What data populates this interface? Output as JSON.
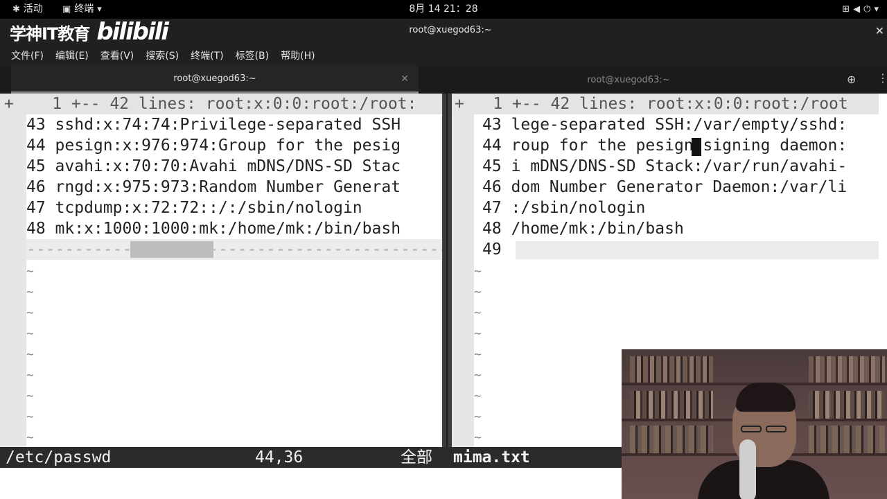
{
  "topbar": {
    "activities": "活动",
    "app_menu": "终端",
    "clock": "8月 14  21：28"
  },
  "window": {
    "logo_text": "学神IT教育",
    "logo_brand": "bilibili",
    "title": "root@xuegod63:~"
  },
  "menubar": [
    "文件(F)",
    "编辑(E)",
    "查看(V)",
    "搜索(S)",
    "终端(T)",
    "标签(B)",
    "帮助(H)"
  ],
  "tabs": [
    {
      "label": "root@xuegod63:~",
      "active": true
    },
    {
      "label": "root@xuegod63:~",
      "active": false
    }
  ],
  "left_pane": {
    "fold_line": "+    1 +-- 42 lines: root:x:0:0:root:/root:",
    "lines": [
      "43 sshd:x:74:74:Privilege-separated SSH",
      "44 pesign:x:976:974:Group for the pesig",
      "45 avahi:x:70:70:Avahi mDNS/DNS-SD Stac",
      "46 rngd:x:975:973:Random Number Generat",
      "47 tcpdump:x:72:72::/:/sbin/nologin",
      "48 mk:x:1000:1000:mk:/home/mk:/bin/bash"
    ],
    "filler_line": "-------------------------------------------------------"
  },
  "right_pane": {
    "fold_line": "+   1 +-- 42 lines: root:x:0:0:root:/root",
    "lines": [
      "43 lege-separated SSH:/var/empty/sshd:",
      "44 roup for the pesign signing daemon:",
      "45 i mDNS/DNS-SD Stack:/var/run/avahi-",
      "46 dom Number Generator Daemon:/var/li",
      "47 :/sbin/nologin",
      "48 /home/mk:/bin/bash",
      "49 "
    ]
  },
  "statusbar": {
    "left_file": "/etc/passwd",
    "cursor_pos": "44,36",
    "scroll": "全部",
    "right_file": "mima.txt"
  },
  "colors": {
    "terminal_bg": "#ffffff",
    "statusbar_bg": "#2b2b2b",
    "window_chrome": "#202020"
  }
}
